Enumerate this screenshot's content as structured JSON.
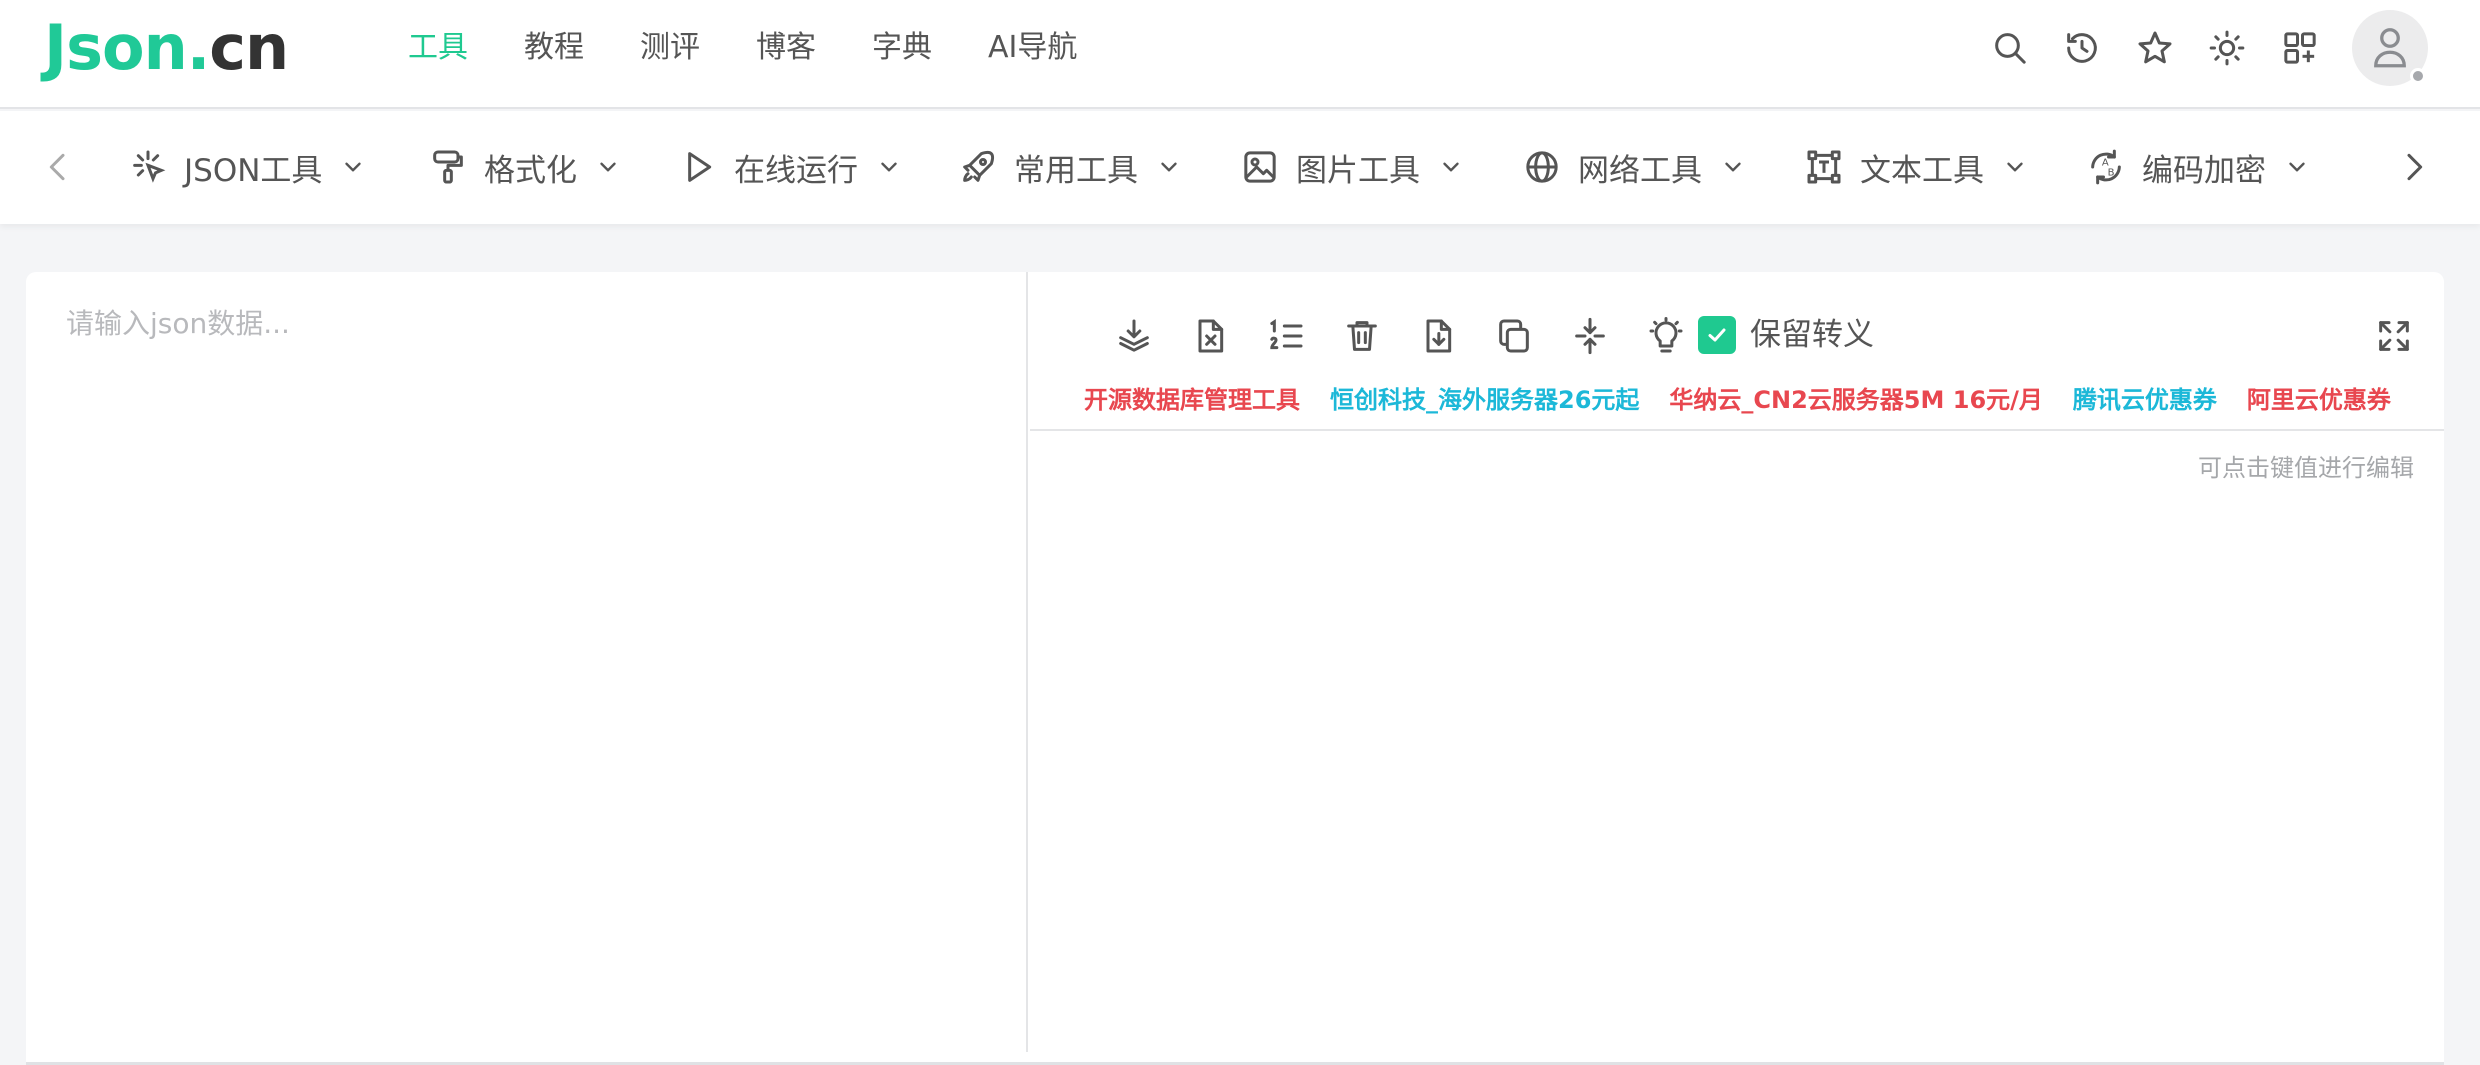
{
  "logo": {
    "part1": "Json.",
    "part2": "cn"
  },
  "nav": {
    "items": [
      {
        "label": "工具",
        "active": true
      },
      {
        "label": "教程"
      },
      {
        "label": "测评"
      },
      {
        "label": "博客"
      },
      {
        "label": "字典"
      },
      {
        "label": "AI导航"
      }
    ]
  },
  "header_icons": [
    "search-icon",
    "history-icon",
    "star-icon",
    "theme-sun-icon",
    "apps-grid-icon",
    "user-avatar"
  ],
  "categories": [
    {
      "label": "JSON工具",
      "icon": "sparkle-cursor-icon"
    },
    {
      "label": "格式化",
      "icon": "paint-roller-icon"
    },
    {
      "label": "在线运行",
      "icon": "play-icon"
    },
    {
      "label": "常用工具",
      "icon": "rocket-icon"
    },
    {
      "label": "图片工具",
      "icon": "image-icon"
    },
    {
      "label": "网络工具",
      "icon": "globe-icon"
    },
    {
      "label": "文本工具",
      "icon": "text-frame-icon"
    },
    {
      "label": "编码加密",
      "icon": "encode-convert-icon"
    }
  ],
  "editor": {
    "placeholder": "请输入json数据...",
    "value": ""
  },
  "toolbar": {
    "buttons": [
      "layers-download-icon",
      "file-x-icon",
      "ordered-list-icon",
      "trash-icon",
      "file-download-icon",
      "copy-icon",
      "compress-icon",
      "lightbulb-icon"
    ],
    "keep_escape_label": "保留转义",
    "keep_escape_checked": true
  },
  "ads": [
    {
      "label": "开源数据库管理工具",
      "color": "red"
    },
    {
      "label": "恒创科技_海外服务器26元起",
      "color": "cyan"
    },
    {
      "label": "华纳云_CN2云服务器5M 16元/月",
      "color": "red"
    },
    {
      "label": "腾讯云优惠券",
      "color": "cyan"
    },
    {
      "label": "阿里云优惠券",
      "color": "red"
    }
  ],
  "output": {
    "hint": "可点击键值进行编辑"
  },
  "colors": {
    "accent": "#1fc990",
    "ad_red": "#e8474f",
    "ad_cyan": "#1cb8d8"
  }
}
